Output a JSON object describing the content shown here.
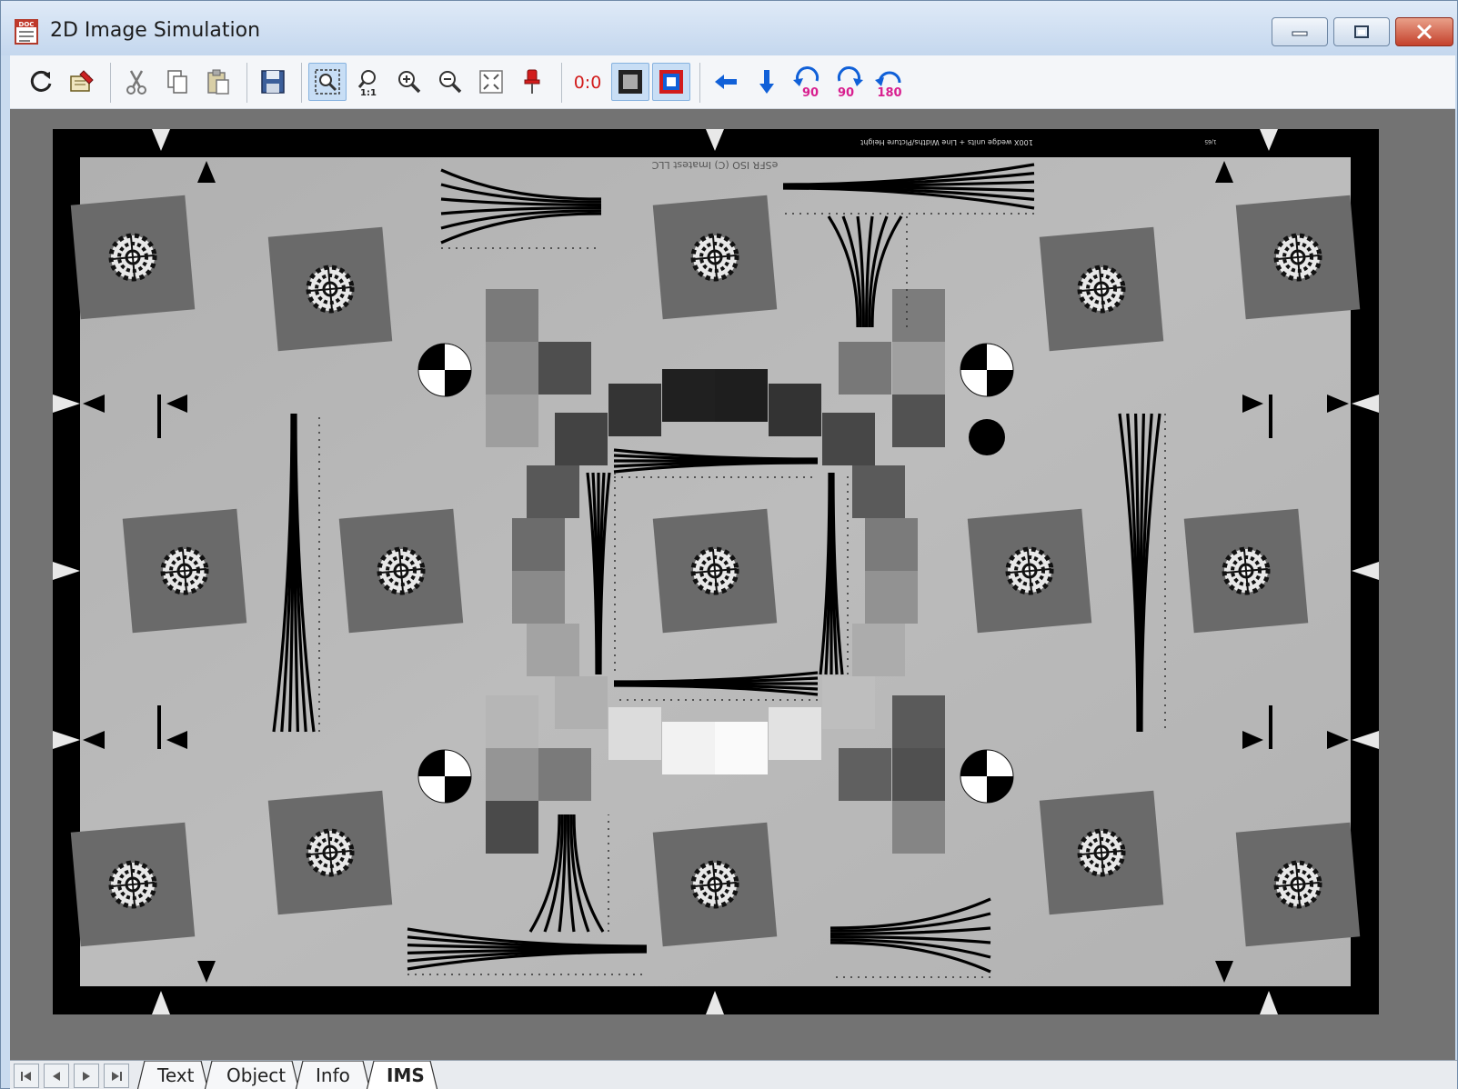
{
  "window": {
    "title": "2D Image Simulation",
    "icon": "doc-app-icon",
    "icon_text": "DOC",
    "controls": [
      "minimize-icon",
      "maximize-icon",
      "close-icon"
    ]
  },
  "toolbar": {
    "zero_label": "0:0",
    "zoom_one_label": "1:1",
    "rotate_ccw_label": "90",
    "rotate_cw_label": "90",
    "rotate_180_label": "180",
    "active_tools": [
      "zoom-to-selection",
      "frame-gray",
      "frame-color"
    ],
    "icons": [
      "refresh-icon",
      "edit-properties-icon",
      "cut-icon",
      "copy-icon",
      "paste-icon",
      "save-icon",
      "zoom-selection-icon",
      "zoom-one-to-one-icon",
      "zoom-in-icon",
      "zoom-out-icon",
      "fit-to-window-icon",
      "pin-icon",
      "origin-icon",
      "gray-frame-icon",
      "color-frame-icon",
      "arrow-left-icon",
      "arrow-down-icon",
      "rotate-left-90-icon",
      "rotate-right-90-icon",
      "rotate-180-icon"
    ]
  },
  "chart": {
    "name": "eSFR ISO test chart",
    "top_text_upside_down": "eSFR ISO (C) Imatest LLC",
    "wedge_caption": "100X wedge units + Line Widths/Picture Height",
    "small_label": "1/65"
  },
  "tabs": {
    "items": [
      "Text",
      "Object",
      "Info",
      "IMS"
    ],
    "active": "IMS"
  },
  "colors": {
    "workspace": "#737373",
    "chart_border": "#000000",
    "chart_background": "#b8b8b8",
    "slanted_square": "#6a6a6a",
    "toolbar_blue": "#1060d8",
    "toolbar_red": "#d21c1c",
    "rotate_magenta": "#d81f8f"
  }
}
